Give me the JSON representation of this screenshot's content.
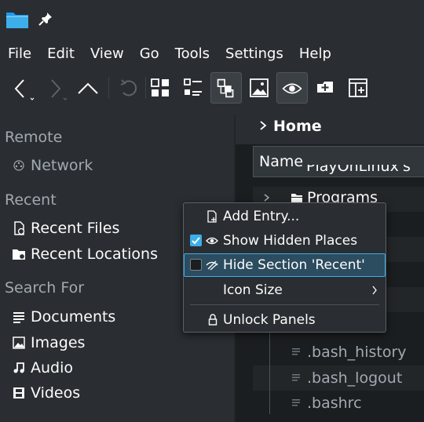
{
  "menubar": {
    "items": [
      "File",
      "Edit",
      "View",
      "Go",
      "Tools",
      "Settings",
      "Help"
    ]
  },
  "toolbar": {
    "icons": [
      "back-icon",
      "forward-icon",
      "up-icon",
      "undo-icon",
      "icons-view-icon",
      "compact-view-icon",
      "details-view-icon",
      "preview-icon",
      "show-hidden-icon",
      "new-tab-icon",
      "split-icon"
    ]
  },
  "places": {
    "sections": {
      "remote": "Remote",
      "recent": "Recent",
      "search": "Search For"
    },
    "remote_items": [
      {
        "label": "Network",
        "icon": "network-icon"
      }
    ],
    "recent_items": [
      {
        "label": "Recent Files",
        "icon": "recent-files-icon"
      },
      {
        "label": "Recent Locations",
        "icon": "recent-locations-icon"
      }
    ],
    "search_items": [
      {
        "label": "Documents",
        "icon": "documents-icon"
      },
      {
        "label": "Images",
        "icon": "images-icon"
      },
      {
        "label": "Audio",
        "icon": "audio-icon"
      },
      {
        "label": "Videos",
        "icon": "videos-icon"
      }
    ]
  },
  "fileview": {
    "breadcrumb": "Home",
    "column_name": "Name",
    "partial_row": "PlayOnLinux's vi",
    "items": [
      {
        "name": "Programs",
        "type": "folder"
      },
      {
        "name": ".bash_history",
        "type": "file"
      },
      {
        "name": ".bash_logout",
        "type": "file"
      },
      {
        "name": ".bashrc",
        "type": "file"
      }
    ]
  },
  "context_menu": {
    "add_entry": "Add Entry...",
    "show_hidden": "Show Hidden Places",
    "show_hidden_checked": true,
    "hide_section": "Hide Section 'Recent'",
    "hide_section_checked": false,
    "icon_size": "Icon Size",
    "unlock_panels": "Unlock Panels"
  },
  "colors": {
    "accent": "#3daee9",
    "window_bg": "#2a2e32",
    "view_bg": "#1b1e20",
    "text": "#fcfcfc",
    "dim_text": "#a1a9b1"
  }
}
